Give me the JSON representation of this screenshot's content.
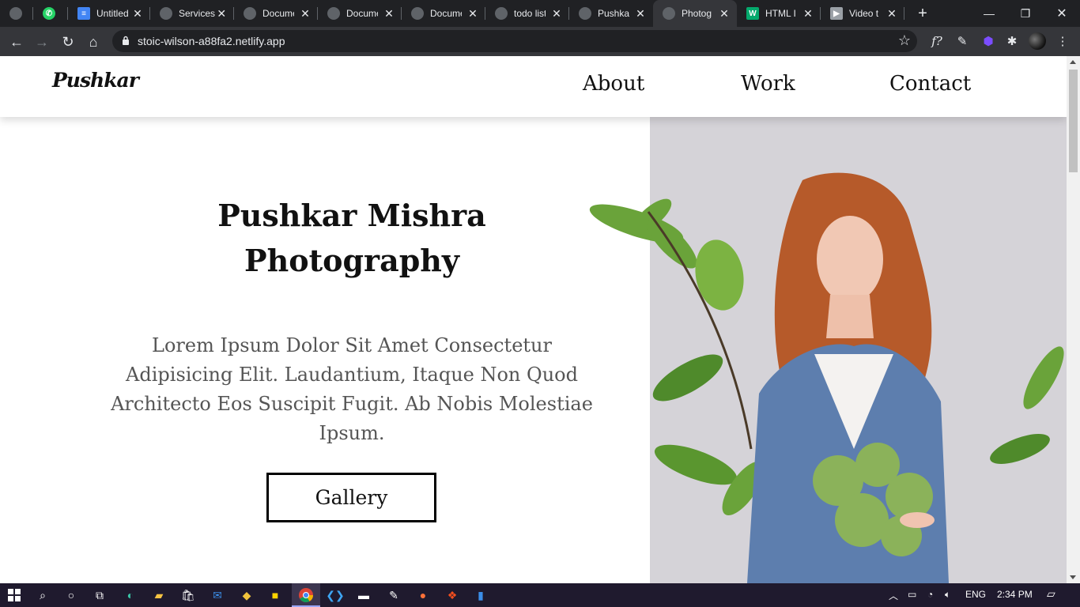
{
  "browser": {
    "tabs": [
      {
        "title": "",
        "favicon": "globe-icon",
        "color": "#5f6368"
      },
      {
        "title": "",
        "favicon": "whatsapp-icon",
        "color": "#25d366"
      },
      {
        "title": "Untitled",
        "favicon": "docs-icon",
        "color": "#4285f4"
      },
      {
        "title": "Services",
        "favicon": "globe-icon",
        "color": "#5f6368"
      },
      {
        "title": "Docume",
        "favicon": "globe-icon",
        "color": "#5f6368"
      },
      {
        "title": "Docume",
        "favicon": "globe-icon",
        "color": "#5f6368"
      },
      {
        "title": "Docume",
        "favicon": "globe-icon",
        "color": "#5f6368"
      },
      {
        "title": "todo list",
        "favicon": "globe-icon",
        "color": "#5f6368"
      },
      {
        "title": "Pushkar",
        "favicon": "globe-icon",
        "color": "#5f6368"
      },
      {
        "title": "Photog",
        "favicon": "globe-icon",
        "color": "#5f6368"
      },
      {
        "title": "HTML I",
        "favicon": "w3schools-icon",
        "color": "#04aa6d"
      },
      {
        "title": "Video t",
        "favicon": "video-icon",
        "color": "#9aa0a6"
      }
    ],
    "url": "stoic-wilson-a88fa2.netlify.app"
  },
  "site": {
    "logo": "Pushkar",
    "nav": [
      "About",
      "Work",
      "Contact"
    ],
    "hero_title_line1": "Pushkar Mishra",
    "hero_title_line2": "Photography",
    "hero_text": "Lorem Ipsum Dolor Sit Amet Consectetur Adipisicing Elit. Laudantium, Itaque Non Quod Architecto Eos Suscipit Fugit. Ab Nobis Molestiae Ipsum.",
    "button": "Gallery"
  },
  "taskbar": {
    "language": "ENG",
    "time": "2:34 PM"
  }
}
